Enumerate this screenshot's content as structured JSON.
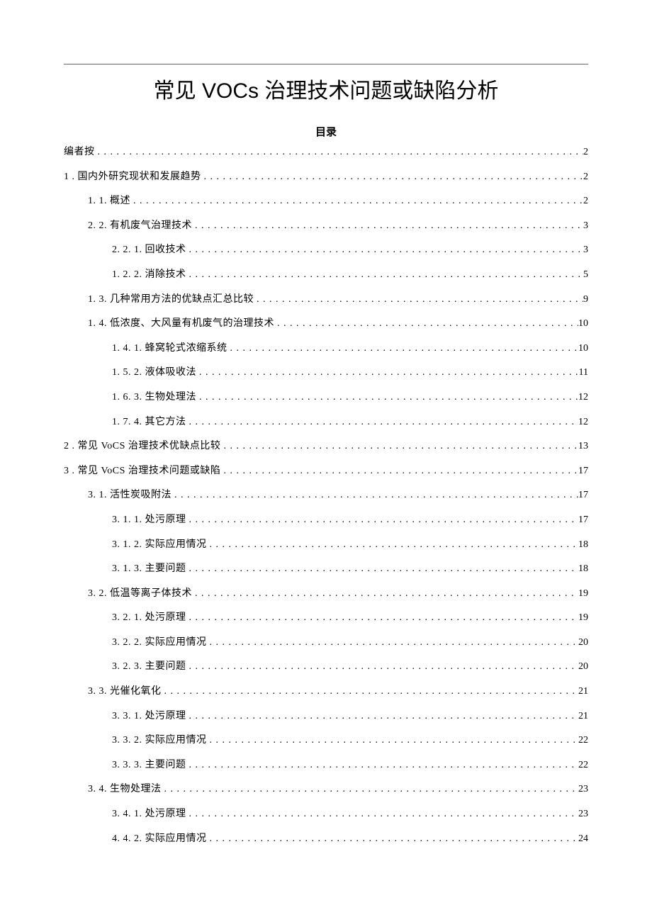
{
  "title": "常见 VOCs 治理技术问题或缺陷分析",
  "toc_header": "目录",
  "toc": [
    {
      "label": "编者按",
      "page": "2",
      "indent": 0
    },
    {
      "label": "1 . 国内外研究现状和发展趋势",
      "page": "2",
      "indent": 0
    },
    {
      "label": "1.  1. 概述",
      "page": "2",
      "indent": 1
    },
    {
      "label": "2.  2. 有机废气治理技术",
      "page": "3",
      "indent": 1
    },
    {
      "label": "2. 2.  1. 回收技术",
      "page": "3",
      "indent": 2
    },
    {
      "label": "1. 2.  2. 消除技术",
      "page": "5",
      "indent": 2
    },
    {
      "label": "1. 3.   几种常用方法的优缺点汇总比较",
      "page": "9",
      "indent": 1
    },
    {
      "label": "1. 4.   低浓度、大风量有机废气的治理技术",
      "page": "10",
      "indent": 1
    },
    {
      "label": "1. 4.  1. 蜂窝轮式浓缩系统",
      "page": "10",
      "indent": 2
    },
    {
      "label": "1. 5.  2. 液体吸收法",
      "page": "11",
      "indent": 2
    },
    {
      "label": "1. 6.  3. 生物处理法",
      "page": "12",
      "indent": 2
    },
    {
      "label": "1. 7.  4. 其它方法",
      "page": "12",
      "indent": 2
    },
    {
      "label": "2   . 常见 VoCS 治理技术优缺点比较",
      "page": "13",
      "indent": 0
    },
    {
      "label": "3   . 常见 VoCS 治理技术问题或缺陷",
      "page": "17",
      "indent": 0
    },
    {
      "label": "3. 1. 活性炭吸附法",
      "page": "17",
      "indent": 1
    },
    {
      "label": "3. 1. 1. 处污原理",
      "page": "17",
      "indent": 2
    },
    {
      "label": "3. 1. 2. 实际应用情况",
      "page": "18",
      "indent": 2
    },
    {
      "label": "3. 1. 3. 主要问题",
      "page": "18",
      "indent": 2
    },
    {
      "label": "3. 2. 低温等离子体技术",
      "page": "19",
      "indent": 1
    },
    {
      "label": "3. 2. 1. 处污原理",
      "page": "19",
      "indent": 2
    },
    {
      "label": "3. 2. 2. 实际应用情况",
      "page": "20",
      "indent": 2
    },
    {
      "label": "3. 2. 3. 主要问题",
      "page": "20",
      "indent": 2
    },
    {
      "label": "3. 3. 光催化氧化",
      "page": "21",
      "indent": 1
    },
    {
      "label": "3. 3. 1. 处污原理",
      "page": "21",
      "indent": 2
    },
    {
      "label": "3. 3. 2. 实际应用情况",
      "page": "22",
      "indent": 2
    },
    {
      "label": "3. 3. 3. 主要问题",
      "page": "22",
      "indent": 2
    },
    {
      "label": "3. 4.   生物处理法",
      "page": "23",
      "indent": 1
    },
    {
      "label": "3.  4. 1. 处污原理",
      "page": "23",
      "indent": 2
    },
    {
      "label": "4.  4. 2. 实际应用情况",
      "page": "24",
      "indent": 2
    }
  ]
}
